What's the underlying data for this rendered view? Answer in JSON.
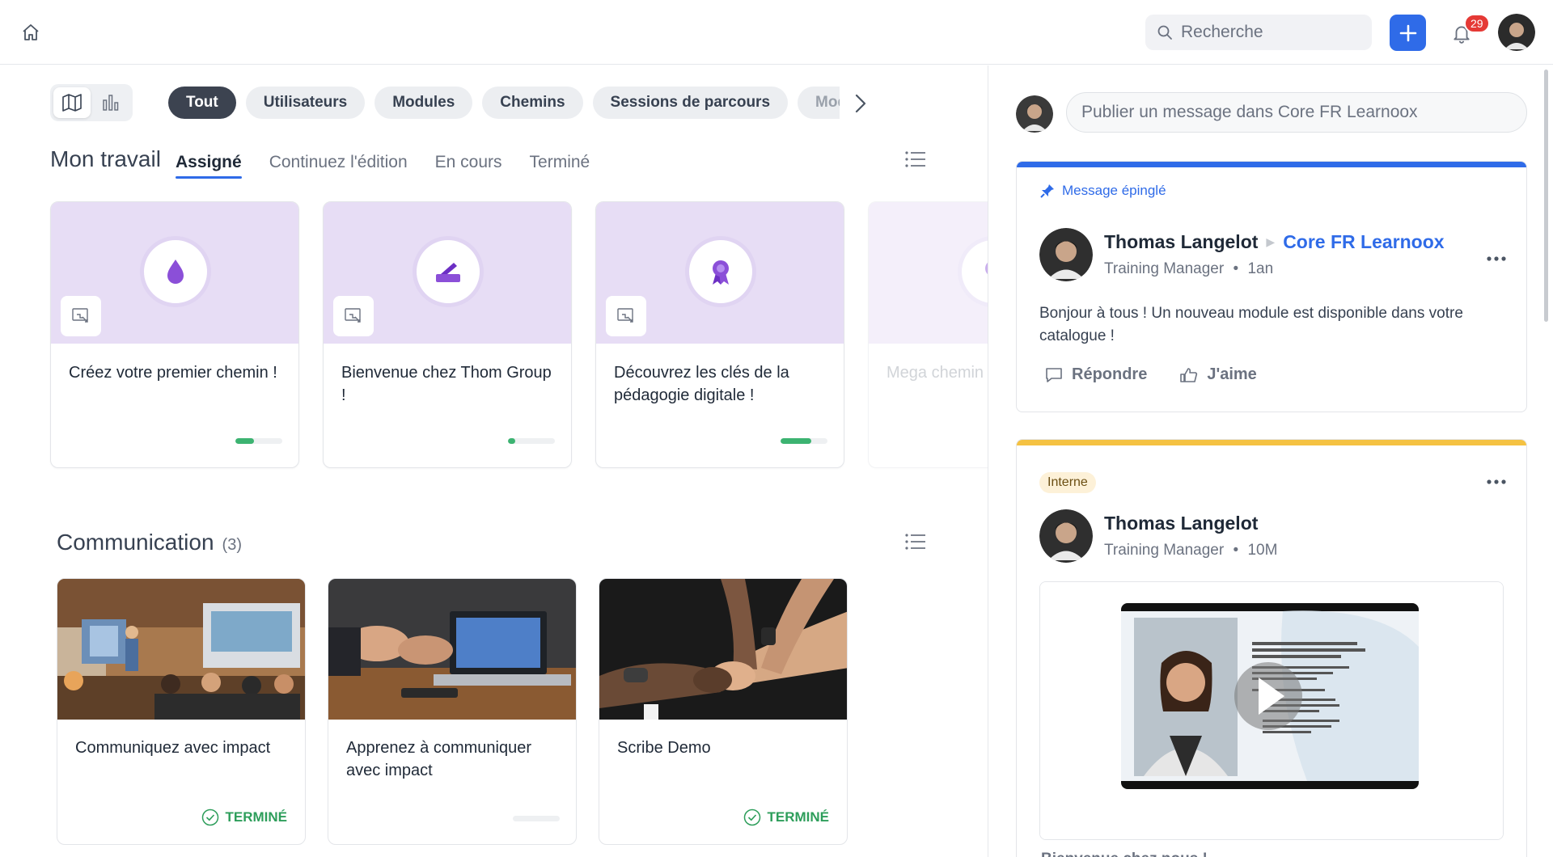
{
  "header": {
    "search_placeholder": "Recherche",
    "notifications_count": "29",
    "accent": "#2f6be8"
  },
  "filters": {
    "chips": [
      "Tout",
      "Utilisateurs",
      "Modules",
      "Chemins",
      "Sessions de parcours",
      "Mod"
    ]
  },
  "work": {
    "title": "Mon travail",
    "tabs": [
      "Assigné",
      "Continuez l'édition",
      "En cours",
      "Terminé"
    ],
    "cards": [
      {
        "title": "Créez votre premier chemin !",
        "progress": 0.4,
        "icon": "drop-icon"
      },
      {
        "title": "Bienvenue chez Thom Group !",
        "progress": 0.15,
        "icon": "signature-icon"
      },
      {
        "title": "Découvrez les clés de la pédagogie digitale !",
        "progress": 0.65,
        "icon": "ribbon-icon"
      },
      {
        "title": "Mega chemin",
        "progress": 0,
        "icon": "ribbon-icon"
      }
    ]
  },
  "communication": {
    "title": "Communication",
    "count": "(3)",
    "cards": [
      {
        "title": "Communiquez avec impact",
        "status": "TERMINÉ"
      },
      {
        "title": "Apprenez à communiquer avec impact",
        "status": ""
      },
      {
        "title": "Scribe Demo",
        "status": "TERMINÉ"
      }
    ]
  },
  "feed": {
    "composer_placeholder": "Publier un message dans Core FR Learnoox",
    "pinned_post": {
      "pinned_label": "Message épinglé",
      "author": "Thomas Langelot",
      "group": "Core FR Learnoox",
      "role": "Training Manager",
      "time": "1an",
      "text": "Bonjour à tous ! Un nouveau module est disponible dans votre catalogue !",
      "reply_label": "Répondre",
      "like_label": "J'aime",
      "color": "#2f6be8"
    },
    "second_post": {
      "tag": "Interne",
      "author": "Thomas Langelot",
      "role": "Training Manager",
      "time": "10M",
      "caption": "Bienvenue chez nous !",
      "color": "#f5c242"
    }
  }
}
